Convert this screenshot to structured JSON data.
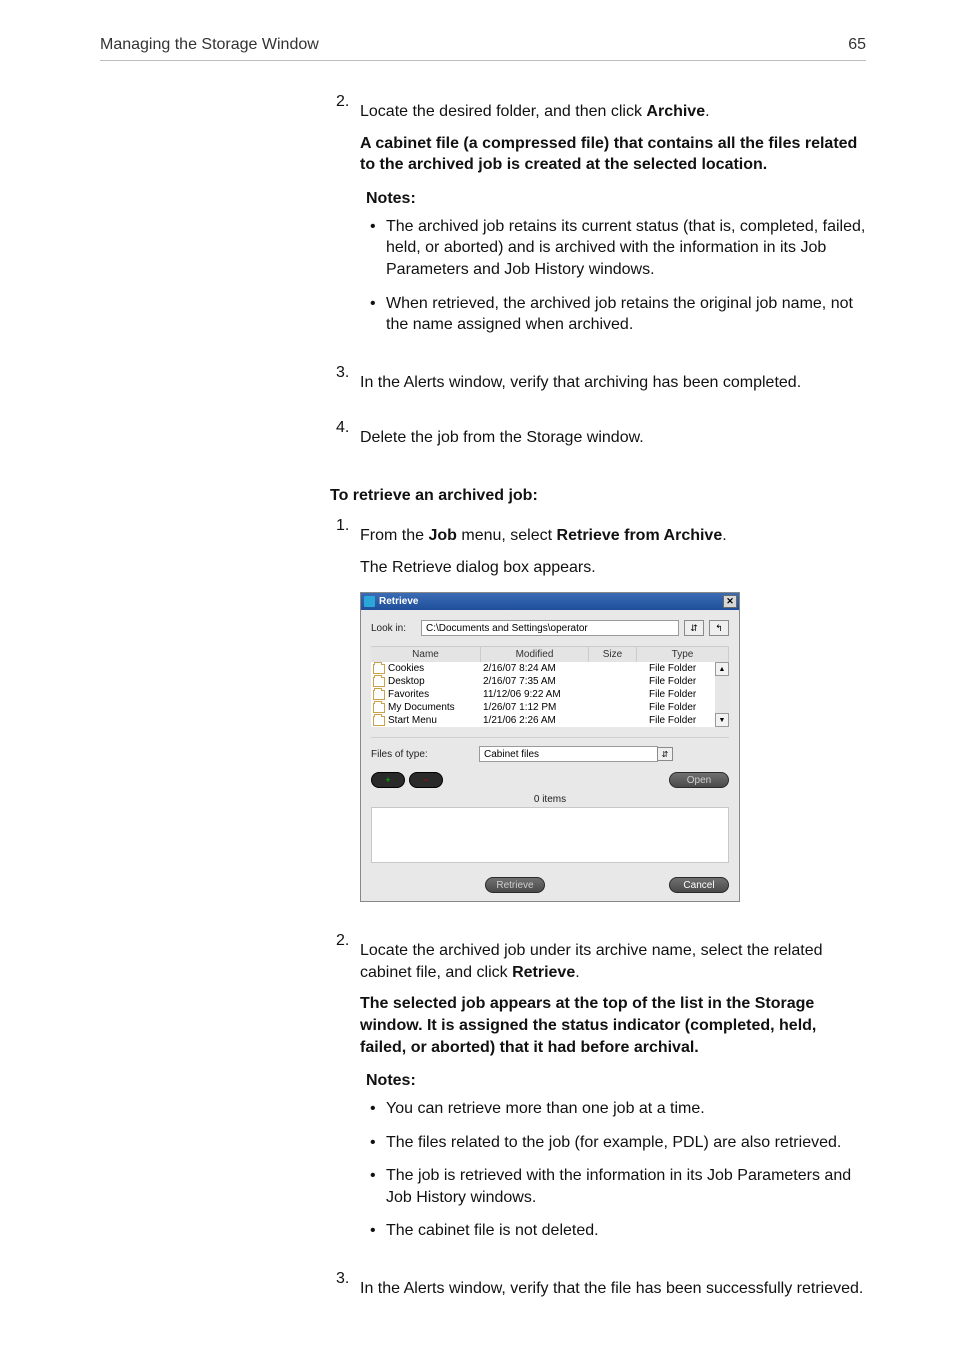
{
  "header": {
    "title": "Managing the Storage Window",
    "page_number": "65"
  },
  "step2": {
    "num": "2.",
    "text_a": "Locate the desired folder, and then click ",
    "text_b": "Archive",
    "text_c": ".",
    "result": "A cabinet file (a compressed file) that contains all the files related to the archived job is created at the selected location.",
    "notes_label": "Notes:",
    "notes": [
      "The archived job retains its current status (that is, completed, failed, held, or aborted) and is archived with the information in its Job Parameters and Job History windows.",
      "When retrieved, the archived job retains the original job name, not the name assigned when archived."
    ]
  },
  "step3": {
    "num": "3.",
    "text": "In the Alerts window, verify that archiving has been completed."
  },
  "step4": {
    "num": "4.",
    "text": "Delete the job from the Storage window."
  },
  "section2_heading": "To retrieve an archived job:",
  "r_step1": {
    "num": "1.",
    "a": "From the ",
    "b": "Job",
    "c": " menu, select ",
    "d": "Retrieve from Archive",
    "e": ".",
    "result": "The Retrieve dialog box appears."
  },
  "dialog": {
    "title": "Retrieve",
    "look_in_label": "Look in:",
    "path": "C:\\Documents and Settings\\operator",
    "sort_glyph": "⇵",
    "up_glyph": "↰",
    "columns": {
      "name": "Name",
      "modified": "Modified",
      "size": "Size",
      "type": "Type"
    },
    "rows": [
      {
        "name": "Cookies",
        "modified": "2/16/07 8:24 AM",
        "size": "",
        "type": "File Folder"
      },
      {
        "name": "Desktop",
        "modified": "2/16/07 7:35 AM",
        "size": "",
        "type": "File Folder"
      },
      {
        "name": "Favorites",
        "modified": "11/12/06 9:22 AM",
        "size": "",
        "type": "File Folder"
      },
      {
        "name": "My Documents",
        "modified": "1/26/07 1:12 PM",
        "size": "",
        "type": "File Folder"
      },
      {
        "name": "Start Menu",
        "modified": "1/21/06 2:26 AM",
        "size": "",
        "type": "File Folder"
      }
    ],
    "scroll_up": "▲",
    "scroll_down": "▼",
    "files_of_type_label": "Files of type:",
    "files_of_type_value": "Cabinet files",
    "dd_glyph": "⇵",
    "add_glyph": "+",
    "remove_glyph": "−",
    "open_label": "Open",
    "items_label": "0 items",
    "retrieve_label": "Retrieve",
    "cancel_label": "Cancel",
    "close_glyph": "✕"
  },
  "r_step2": {
    "num": "2.",
    "a": "Locate the archived job under its archive name, select the related cabinet file, and click ",
    "b": "Retrieve",
    "c": ".",
    "result_a": "The selected job appears at the top of the list in the Storage window. It is assigned the status indicator (",
    "result_b": "completed",
    "result_c": ", ",
    "result_d": "held",
    "result_e": ", ",
    "result_f": "failed",
    "result_g": ", or ",
    "result_h": "aborted",
    "result_i": ") that it had before archival.",
    "notes_label": "Notes:",
    "notes": [
      "You can retrieve more than one job at a time.",
      "The files related to the job (for example, PDL) are also retrieved.",
      "The job is retrieved with the information in its Job Parameters and Job History windows.",
      "The cabinet file is not deleted."
    ]
  },
  "r_step3": {
    "num": "3.",
    "text": "In the Alerts window, verify that the file has been successfully retrieved."
  }
}
